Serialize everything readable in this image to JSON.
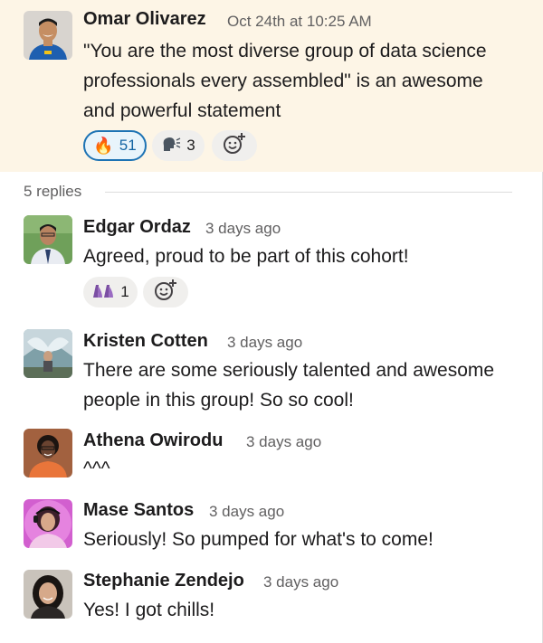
{
  "parent": {
    "author": "Omar Olivarez",
    "time": "Oct 24th at 10:25 AM",
    "lines": [
      "\"You are the most diverse group of data science",
      "professionals every assembled\" is an awesome",
      "and powerful statement"
    ],
    "reactions": [
      {
        "emoji": "🔥",
        "icon": "fire-icon",
        "count": "51",
        "active": true
      },
      {
        "emoji": "🗣",
        "icon": "speaking-head-icon",
        "count": "3",
        "active": false
      }
    ]
  },
  "replies_label": "5 replies",
  "replies": [
    {
      "author": "Edgar Ordaz",
      "time": "3 days ago",
      "lines": [
        "Agreed, proud to be part of this cohort!"
      ],
      "reaction": {
        "emoji": "👠👠",
        "icon": "heels-icon",
        "count": "1"
      }
    },
    {
      "author": "Kristen Cotten",
      "time": "3 days ago",
      "lines": [
        "There are some seriously talented and awesome",
        "people in this group! So so cool!"
      ]
    },
    {
      "author": "Athena Owirodu",
      "time": "3 days ago",
      "lines": [
        "^^^"
      ]
    },
    {
      "author": "Mase Santos",
      "time": "3 days ago",
      "lines": [
        "Seriously! So pumped for what's to come!"
      ]
    },
    {
      "author": "Stephanie Zendejo",
      "time": "3 days ago",
      "lines": [
        "Yes! I got chills!"
      ]
    }
  ],
  "colors": {
    "parent_bg": "#fdf5e6",
    "active_reaction_border": "#1d73b4",
    "active_reaction_bg": "#e8f4fb"
  }
}
